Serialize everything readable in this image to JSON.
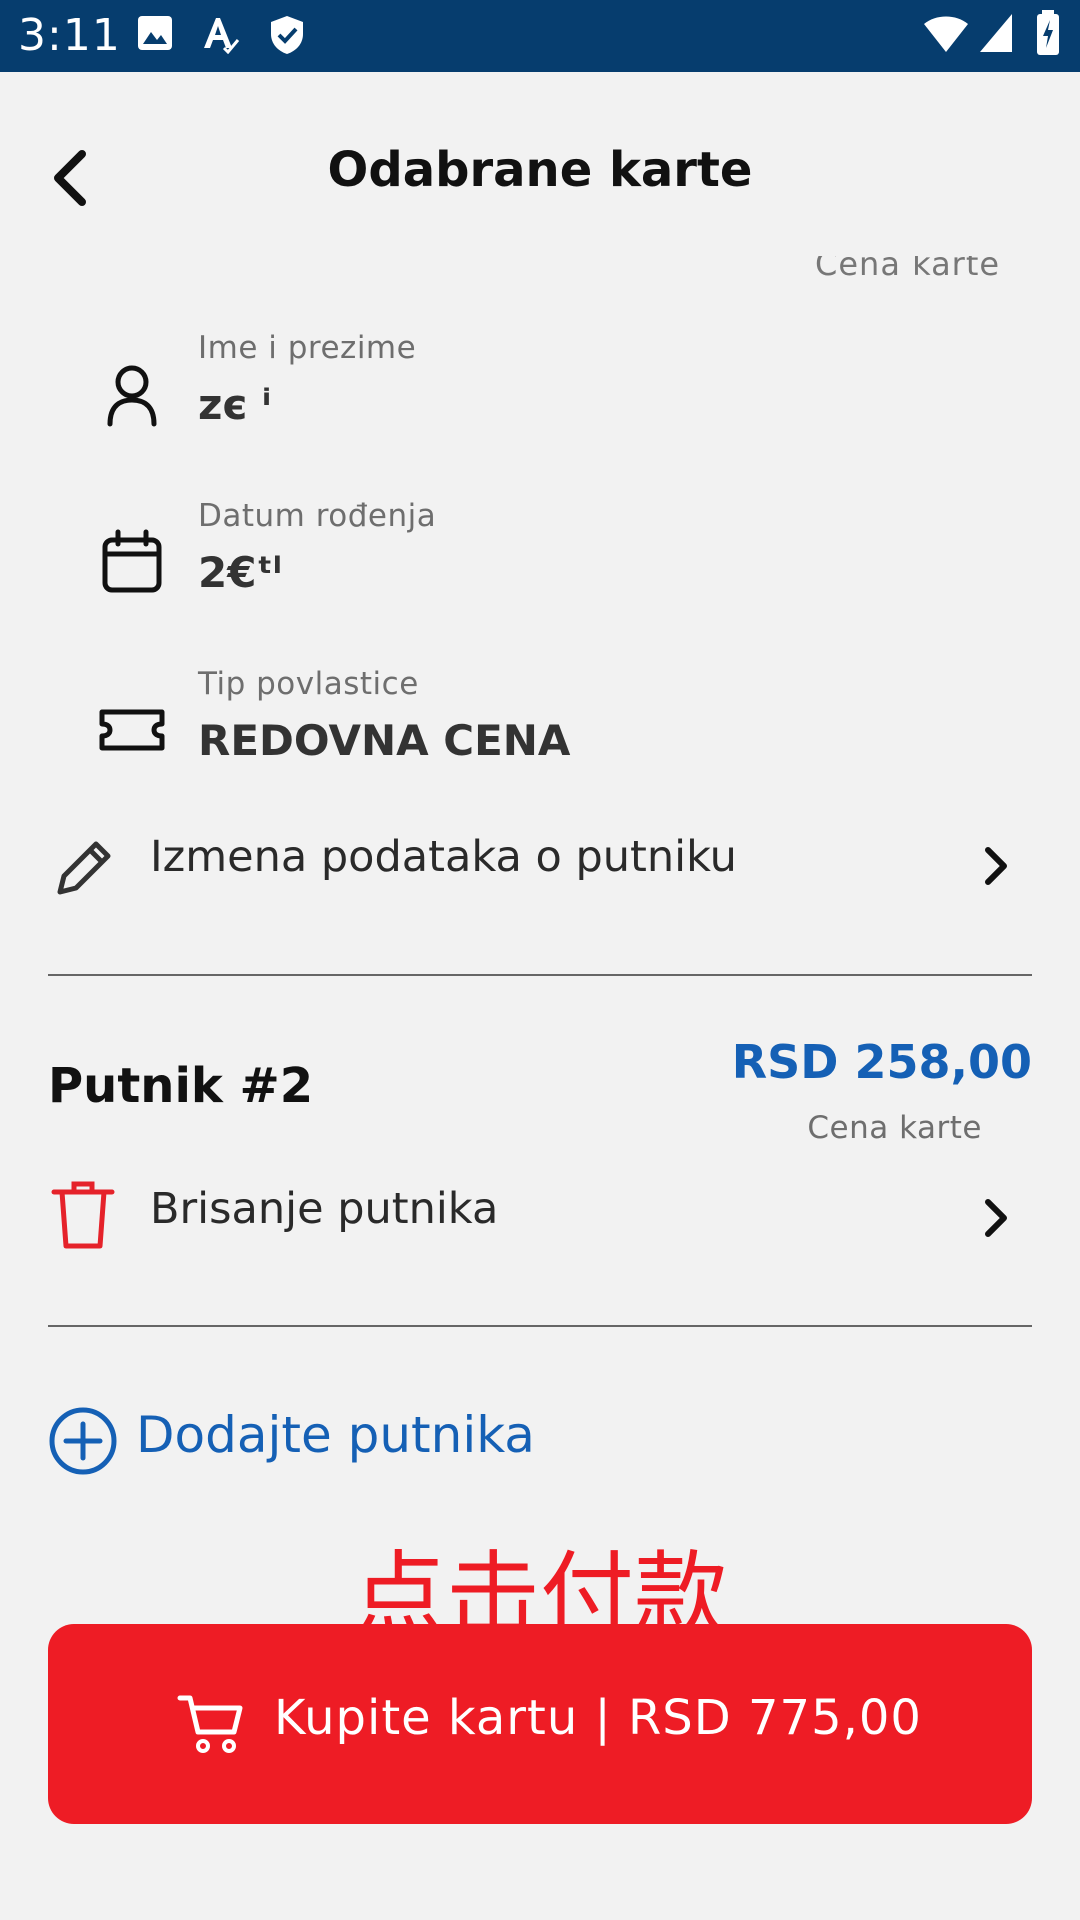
{
  "status_bar": {
    "time": "3:11",
    "background": "#063d6e",
    "left_icons": [
      "image-icon",
      "font-icon",
      "shield-check-icon"
    ],
    "right_icons": [
      "wifi-icon",
      "signal-icon",
      "battery-charging-icon"
    ]
  },
  "header": {
    "title": "Odabrane karte"
  },
  "passenger_1": {
    "price_caption_partial": "Cena karte",
    "name": {
      "label": "Ime i prezime",
      "value": "zє ⁱ"
    },
    "birth_date": {
      "label": "Datum rođenja",
      "value": "2€ᵗˡ"
    },
    "discount": {
      "label": "Tip povlastice",
      "value": "REDOVNA CENA"
    },
    "edit_action": "Izmena podataka o putniku"
  },
  "passenger_2": {
    "title": "Putnik #2",
    "price": "RSD 258,00",
    "price_caption": "Cena karte",
    "delete_action": "Brisanje putnika"
  },
  "add_passenger": "Dodajte putnika",
  "annotation": "点击付款",
  "buy_button": {
    "label": "Kupite kartu | RSD 775,00"
  },
  "colors": {
    "accent_blue": "#1560b5",
    "danger_red": "#ee1c25",
    "background": "#f2f2f2"
  }
}
